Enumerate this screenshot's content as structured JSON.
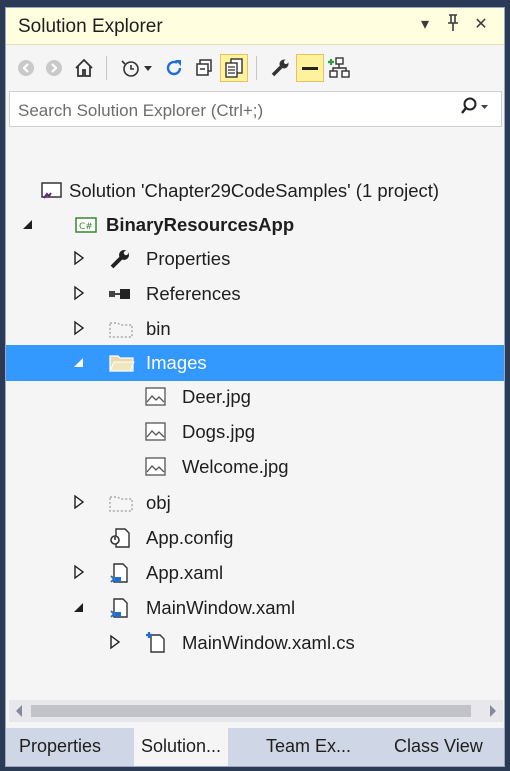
{
  "window": {
    "title": "Solution Explorer"
  },
  "search": {
    "placeholder": "Search Solution Explorer (Ctrl+;)"
  },
  "tree": {
    "solution": "Solution 'Chapter29CodeSamples' (1 project)",
    "project": "BinaryResourcesApp",
    "items": {
      "properties": "Properties",
      "references": "References",
      "bin": "bin",
      "images": "Images",
      "deer": "Deer.jpg",
      "dogs": "Dogs.jpg",
      "welcome": "Welcome.jpg",
      "obj": "obj",
      "appconfig": "App.config",
      "appxaml": "App.xaml",
      "mainwindow": "MainWindow.xaml",
      "mainwindowcs": "MainWindow.xaml.cs"
    }
  },
  "tabs": [
    "Properties",
    "Solution...",
    "Team Ex...",
    "Class View"
  ],
  "colors": {
    "selection": "#3399ff",
    "title_bg": "#ffffe0",
    "tab_bar": "#cfd6e5"
  }
}
